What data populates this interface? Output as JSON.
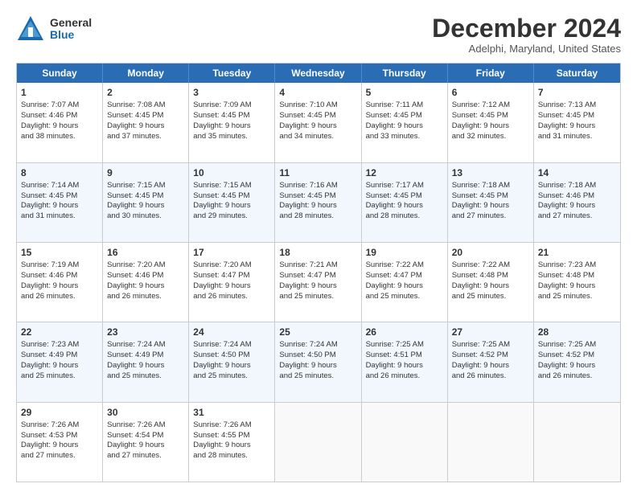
{
  "logo": {
    "general": "General",
    "blue": "Blue"
  },
  "title": "December 2024",
  "subtitle": "Adelphi, Maryland, United States",
  "days": [
    "Sunday",
    "Monday",
    "Tuesday",
    "Wednesday",
    "Thursday",
    "Friday",
    "Saturday"
  ],
  "rows": [
    [
      {
        "num": "1",
        "lines": [
          "Sunrise: 7:07 AM",
          "Sunset: 4:46 PM",
          "Daylight: 9 hours",
          "and 38 minutes."
        ]
      },
      {
        "num": "2",
        "lines": [
          "Sunrise: 7:08 AM",
          "Sunset: 4:45 PM",
          "Daylight: 9 hours",
          "and 37 minutes."
        ]
      },
      {
        "num": "3",
        "lines": [
          "Sunrise: 7:09 AM",
          "Sunset: 4:45 PM",
          "Daylight: 9 hours",
          "and 35 minutes."
        ]
      },
      {
        "num": "4",
        "lines": [
          "Sunrise: 7:10 AM",
          "Sunset: 4:45 PM",
          "Daylight: 9 hours",
          "and 34 minutes."
        ]
      },
      {
        "num": "5",
        "lines": [
          "Sunrise: 7:11 AM",
          "Sunset: 4:45 PM",
          "Daylight: 9 hours",
          "and 33 minutes."
        ]
      },
      {
        "num": "6",
        "lines": [
          "Sunrise: 7:12 AM",
          "Sunset: 4:45 PM",
          "Daylight: 9 hours",
          "and 32 minutes."
        ]
      },
      {
        "num": "7",
        "lines": [
          "Sunrise: 7:13 AM",
          "Sunset: 4:45 PM",
          "Daylight: 9 hours",
          "and 31 minutes."
        ]
      }
    ],
    [
      {
        "num": "8",
        "lines": [
          "Sunrise: 7:14 AM",
          "Sunset: 4:45 PM",
          "Daylight: 9 hours",
          "and 31 minutes."
        ]
      },
      {
        "num": "9",
        "lines": [
          "Sunrise: 7:15 AM",
          "Sunset: 4:45 PM",
          "Daylight: 9 hours",
          "and 30 minutes."
        ]
      },
      {
        "num": "10",
        "lines": [
          "Sunrise: 7:15 AM",
          "Sunset: 4:45 PM",
          "Daylight: 9 hours",
          "and 29 minutes."
        ]
      },
      {
        "num": "11",
        "lines": [
          "Sunrise: 7:16 AM",
          "Sunset: 4:45 PM",
          "Daylight: 9 hours",
          "and 28 minutes."
        ]
      },
      {
        "num": "12",
        "lines": [
          "Sunrise: 7:17 AM",
          "Sunset: 4:45 PM",
          "Daylight: 9 hours",
          "and 28 minutes."
        ]
      },
      {
        "num": "13",
        "lines": [
          "Sunrise: 7:18 AM",
          "Sunset: 4:45 PM",
          "Daylight: 9 hours",
          "and 27 minutes."
        ]
      },
      {
        "num": "14",
        "lines": [
          "Sunrise: 7:18 AM",
          "Sunset: 4:46 PM",
          "Daylight: 9 hours",
          "and 27 minutes."
        ]
      }
    ],
    [
      {
        "num": "15",
        "lines": [
          "Sunrise: 7:19 AM",
          "Sunset: 4:46 PM",
          "Daylight: 9 hours",
          "and 26 minutes."
        ]
      },
      {
        "num": "16",
        "lines": [
          "Sunrise: 7:20 AM",
          "Sunset: 4:46 PM",
          "Daylight: 9 hours",
          "and 26 minutes."
        ]
      },
      {
        "num": "17",
        "lines": [
          "Sunrise: 7:20 AM",
          "Sunset: 4:47 PM",
          "Daylight: 9 hours",
          "and 26 minutes."
        ]
      },
      {
        "num": "18",
        "lines": [
          "Sunrise: 7:21 AM",
          "Sunset: 4:47 PM",
          "Daylight: 9 hours",
          "and 25 minutes."
        ]
      },
      {
        "num": "19",
        "lines": [
          "Sunrise: 7:22 AM",
          "Sunset: 4:47 PM",
          "Daylight: 9 hours",
          "and 25 minutes."
        ]
      },
      {
        "num": "20",
        "lines": [
          "Sunrise: 7:22 AM",
          "Sunset: 4:48 PM",
          "Daylight: 9 hours",
          "and 25 minutes."
        ]
      },
      {
        "num": "21",
        "lines": [
          "Sunrise: 7:23 AM",
          "Sunset: 4:48 PM",
          "Daylight: 9 hours",
          "and 25 minutes."
        ]
      }
    ],
    [
      {
        "num": "22",
        "lines": [
          "Sunrise: 7:23 AM",
          "Sunset: 4:49 PM",
          "Daylight: 9 hours",
          "and 25 minutes."
        ]
      },
      {
        "num": "23",
        "lines": [
          "Sunrise: 7:24 AM",
          "Sunset: 4:49 PM",
          "Daylight: 9 hours",
          "and 25 minutes."
        ]
      },
      {
        "num": "24",
        "lines": [
          "Sunrise: 7:24 AM",
          "Sunset: 4:50 PM",
          "Daylight: 9 hours",
          "and 25 minutes."
        ]
      },
      {
        "num": "25",
        "lines": [
          "Sunrise: 7:24 AM",
          "Sunset: 4:50 PM",
          "Daylight: 9 hours",
          "and 25 minutes."
        ]
      },
      {
        "num": "26",
        "lines": [
          "Sunrise: 7:25 AM",
          "Sunset: 4:51 PM",
          "Daylight: 9 hours",
          "and 26 minutes."
        ]
      },
      {
        "num": "27",
        "lines": [
          "Sunrise: 7:25 AM",
          "Sunset: 4:52 PM",
          "Daylight: 9 hours",
          "and 26 minutes."
        ]
      },
      {
        "num": "28",
        "lines": [
          "Sunrise: 7:25 AM",
          "Sunset: 4:52 PM",
          "Daylight: 9 hours",
          "and 26 minutes."
        ]
      }
    ],
    [
      {
        "num": "29",
        "lines": [
          "Sunrise: 7:26 AM",
          "Sunset: 4:53 PM",
          "Daylight: 9 hours",
          "and 27 minutes."
        ]
      },
      {
        "num": "30",
        "lines": [
          "Sunrise: 7:26 AM",
          "Sunset: 4:54 PM",
          "Daylight: 9 hours",
          "and 27 minutes."
        ]
      },
      {
        "num": "31",
        "lines": [
          "Sunrise: 7:26 AM",
          "Sunset: 4:55 PM",
          "Daylight: 9 hours",
          "and 28 minutes."
        ]
      },
      null,
      null,
      null,
      null
    ]
  ]
}
